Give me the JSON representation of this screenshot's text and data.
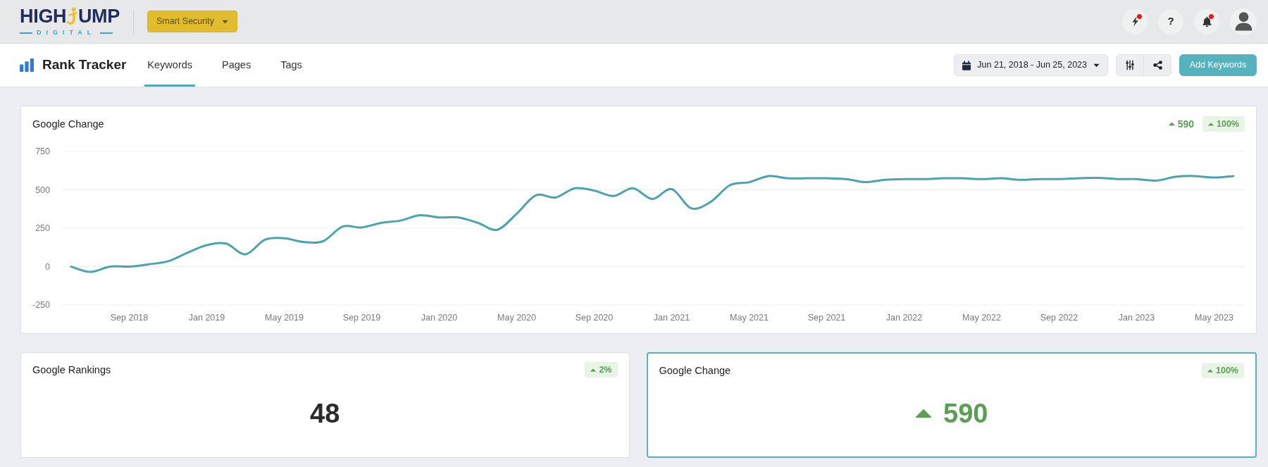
{
  "top_bar": {
    "logo": {
      "word_1": "HIGH",
      "word_2": "UMP",
      "tagline": "DIGITAL"
    },
    "project_selector": {
      "label": "Smart Security"
    },
    "icons": [
      {
        "kind": "flash",
        "unread": true
      },
      {
        "kind": "help",
        "label": "?",
        "unread": false
      },
      {
        "kind": "bell",
        "unread": true
      },
      {
        "kind": "avatar",
        "unread": false
      }
    ]
  },
  "header": {
    "title": "Rank Tracker",
    "tabs": [
      {
        "label": "Keywords",
        "selected": true
      },
      {
        "label": "Pages",
        "selected": false
      },
      {
        "label": "Tags",
        "selected": false
      }
    ],
    "date_range": "Jun 21, 2018 - Jun 25, 2023",
    "tool_buttons": [
      {
        "kind": "filters"
      },
      {
        "kind": "share"
      }
    ],
    "primary_button": "Add Keywords"
  },
  "trend_card": {
    "title": "Google Change",
    "change": {
      "value": "590",
      "increase": true
    },
    "badge": {
      "text": "100%",
      "increase": true
    },
    "chart_data": {
      "type": "line",
      "categories": [
        null,
        null,
        null,
        "Sep 2018",
        null,
        null,
        null,
        "Jan 2019",
        null,
        null,
        null,
        "May 2019",
        null,
        null,
        null,
        "Sep 2019",
        null,
        null,
        null,
        "Jan 2020",
        null,
        null,
        null,
        "May 2020",
        null,
        null,
        null,
        "Sep 2020",
        null,
        null,
        null,
        "Jan 2021",
        null,
        null,
        null,
        "May 2021",
        null,
        null,
        null,
        "Sep 2021",
        null,
        null,
        null,
        "Jan 2022",
        null,
        null,
        null,
        "May 2022",
        null,
        null,
        null,
        "Sep 2022",
        null,
        null,
        null,
        "Jan 2023",
        null,
        null,
        null,
        "May 2023",
        null
      ],
      "series": [
        {
          "color": "#4aa3ad",
          "values": [
            0,
            -35,
            0,
            0,
            15,
            35,
            90,
            140,
            150,
            80,
            175,
            185,
            160,
            165,
            260,
            255,
            285,
            300,
            335,
            320,
            320,
            285,
            240,
            345,
            465,
            450,
            510,
            495,
            460,
            510,
            440,
            505,
            380,
            420,
            530,
            550,
            590,
            575,
            575,
            575,
            570,
            550,
            565,
            570,
            570,
            575,
            575,
            570,
            575,
            565,
            570,
            570,
            575,
            578,
            570,
            570,
            560,
            585,
            590,
            580,
            590
          ]
        }
      ],
      "ylim": [
        -250,
        750
      ],
      "yticks": [
        -250,
        0,
        250,
        500,
        750
      ],
      "grid": true
    }
  },
  "stat_cards": [
    {
      "title": "Google Rankings",
      "badge": {
        "text": "2%",
        "increase": true
      },
      "value": "48",
      "show_arrow": false,
      "selected": false
    },
    {
      "title": "Google Change",
      "badge": {
        "text": "100%",
        "increase": true
      },
      "value": "590",
      "show_arrow": true,
      "increase": true,
      "selected": true
    }
  ]
}
